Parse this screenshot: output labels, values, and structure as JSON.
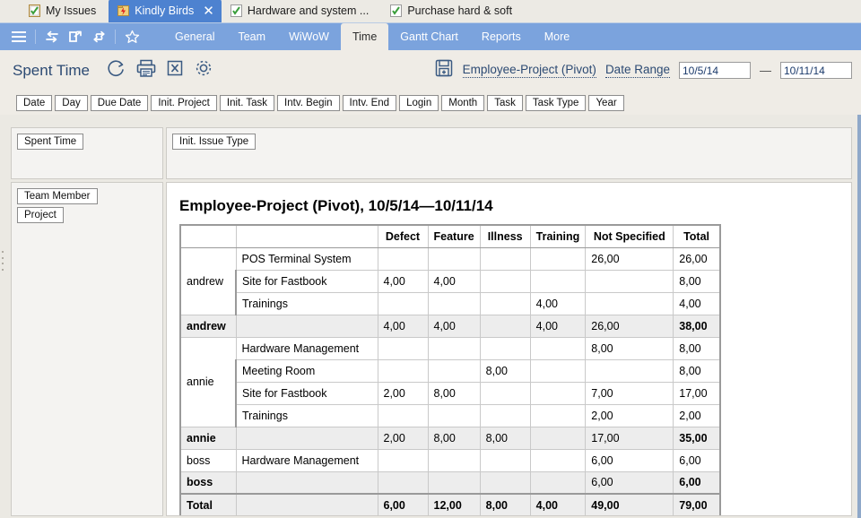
{
  "tabs": [
    {
      "label": "My Issues",
      "icon": "checked-document-icon",
      "active": false,
      "closable": false
    },
    {
      "label": "Kindly Birds",
      "icon": "folder-bolt-icon",
      "active": true,
      "closable": true
    },
    {
      "label": "Hardware and system ...",
      "icon": "checked-document-icon",
      "active": false,
      "closable": false
    },
    {
      "label": "Purchase hard & soft",
      "icon": "checked-document-icon",
      "active": false,
      "closable": false
    }
  ],
  "tab_close_glyph": "✕",
  "navbar": {
    "icons": [
      {
        "name": "hamburger-menu-icon"
      },
      {
        "name": "swap-arrows-icon"
      },
      {
        "name": "open-external-icon"
      },
      {
        "name": "refresh-arrows-icon"
      },
      {
        "name": "star-favorite-icon"
      }
    ],
    "items": [
      {
        "label": "General",
        "active": false
      },
      {
        "label": "Team",
        "active": false
      },
      {
        "label": "WiWoW",
        "active": false
      },
      {
        "label": "Time",
        "active": true
      },
      {
        "label": "Gantt Chart",
        "active": false
      },
      {
        "label": "Reports",
        "active": false
      },
      {
        "label": "More",
        "active": false
      }
    ]
  },
  "header": {
    "title": "Spent Time",
    "icons": [
      {
        "name": "refresh-circle-icon"
      },
      {
        "name": "print-icon"
      },
      {
        "name": "excel-export-icon"
      },
      {
        "name": "settings-gear-icon"
      }
    ],
    "save_icon": "save-add-icon",
    "report_link": "Employee-Project (Pivot)",
    "date_range_link": "Date Range",
    "date_from": "10/5/14",
    "date_to": "10/11/14",
    "date_separator": "—"
  },
  "field_chips": [
    "Date",
    "Day",
    "Due Date",
    "Init. Project",
    "Init. Task",
    "Intv. Begin",
    "Intv. End",
    "Login",
    "Month",
    "Task",
    "Task Type",
    "Year"
  ],
  "panels": {
    "measure_chip": "Spent Time",
    "column_chip": "Init. Issue Type",
    "row_chips": [
      "Team Member",
      "Project"
    ]
  },
  "chart_data": {
    "type": "table",
    "title": "Employee-Project (Pivot), 10/5/14—10/11/14",
    "row_headers": [
      "",
      ""
    ],
    "columns": [
      "Defect",
      "Feature",
      "Illness",
      "Training",
      "Not Specified",
      "Total"
    ],
    "rows": [
      {
        "kind": "detail",
        "employee": "andrew",
        "project": "POS Terminal System",
        "values": [
          "",
          "",
          "",
          "",
          "26,00",
          "26,00"
        ]
      },
      {
        "kind": "detail",
        "employee": "",
        "project": "Site for Fastbook",
        "values": [
          "4,00",
          "4,00",
          "",
          "",
          "",
          "8,00"
        ]
      },
      {
        "kind": "detail",
        "employee": "",
        "project": "Trainings",
        "values": [
          "",
          "",
          "",
          "4,00",
          "",
          "4,00"
        ]
      },
      {
        "kind": "subtotal",
        "employee": "andrew",
        "project": "",
        "values": [
          "4,00",
          "4,00",
          "",
          "4,00",
          "26,00",
          "38,00"
        ]
      },
      {
        "kind": "detail",
        "employee": "annie",
        "project": "Hardware Management",
        "values": [
          "",
          "",
          "",
          "",
          "8,00",
          "8,00"
        ]
      },
      {
        "kind": "detail",
        "employee": "",
        "project": "Meeting Room",
        "values": [
          "",
          "",
          "8,00",
          "",
          "",
          "8,00"
        ]
      },
      {
        "kind": "detail",
        "employee": "",
        "project": "Site for Fastbook",
        "values": [
          "2,00",
          "8,00",
          "",
          "",
          "7,00",
          "17,00"
        ]
      },
      {
        "kind": "detail",
        "employee": "",
        "project": "Trainings",
        "values": [
          "",
          "",
          "",
          "",
          "2,00",
          "2,00"
        ]
      },
      {
        "kind": "subtotal",
        "employee": "annie",
        "project": "",
        "values": [
          "2,00",
          "8,00",
          "8,00",
          "",
          "17,00",
          "35,00"
        ]
      },
      {
        "kind": "detail",
        "employee": "boss",
        "project": "Hardware Management",
        "values": [
          "",
          "",
          "",
          "",
          "6,00",
          "6,00"
        ]
      },
      {
        "kind": "subtotal",
        "employee": "boss",
        "project": "",
        "values": [
          "",
          "",
          "",
          "",
          "6,00",
          "6,00"
        ]
      },
      {
        "kind": "grandtotal",
        "employee": "Total",
        "project": "",
        "values": [
          "6,00",
          "12,00",
          "8,00",
          "4,00",
          "49,00",
          "79,00"
        ]
      }
    ]
  },
  "colors": {
    "tab_active_bg": "#4d82d0",
    "navbar_bg": "#7ba3dd",
    "header_bg": "#efece6",
    "subtotal_bg": "#ededed",
    "title_blue": "#2c4a73"
  }
}
